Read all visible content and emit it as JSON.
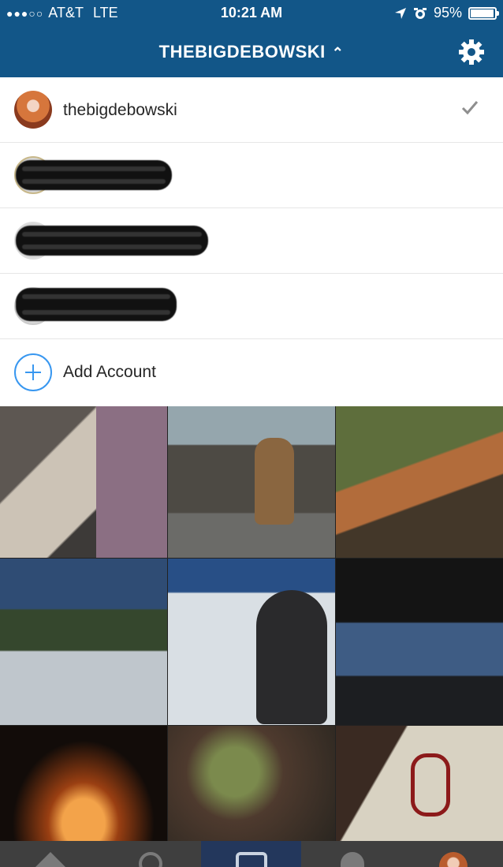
{
  "status_bar": {
    "signal_dots": "●●●○○",
    "carrier": "AT&T",
    "network": "LTE",
    "time": "10:21 AM",
    "battery_text": "95%",
    "battery_level": 0.95,
    "icons": [
      "location-arrow-icon",
      "alarm-clock-icon",
      "battery-icon"
    ]
  },
  "header": {
    "title": "THEBIGDEBOWSKI",
    "chevron_icon": "chevron-up-icon",
    "settings_icon": "gear-icon",
    "bg_color": "#125688"
  },
  "accounts": {
    "current": {
      "username": "thebigdebowski",
      "selected_icon": "checkmark-icon"
    },
    "redacted_count": 3,
    "add_label": "Add Account",
    "add_icon": "plus-circle-icon",
    "accent_color": "#3897f0"
  },
  "tabbar": {
    "tabs": [
      {
        "name": "home",
        "icon": "home-icon"
      },
      {
        "name": "search",
        "icon": "search-icon"
      },
      {
        "name": "camera",
        "icon": "camera-icon",
        "active": true
      },
      {
        "name": "activity",
        "icon": "heart-icon"
      },
      {
        "name": "profile",
        "icon": "profile-avatar-icon"
      }
    ]
  }
}
